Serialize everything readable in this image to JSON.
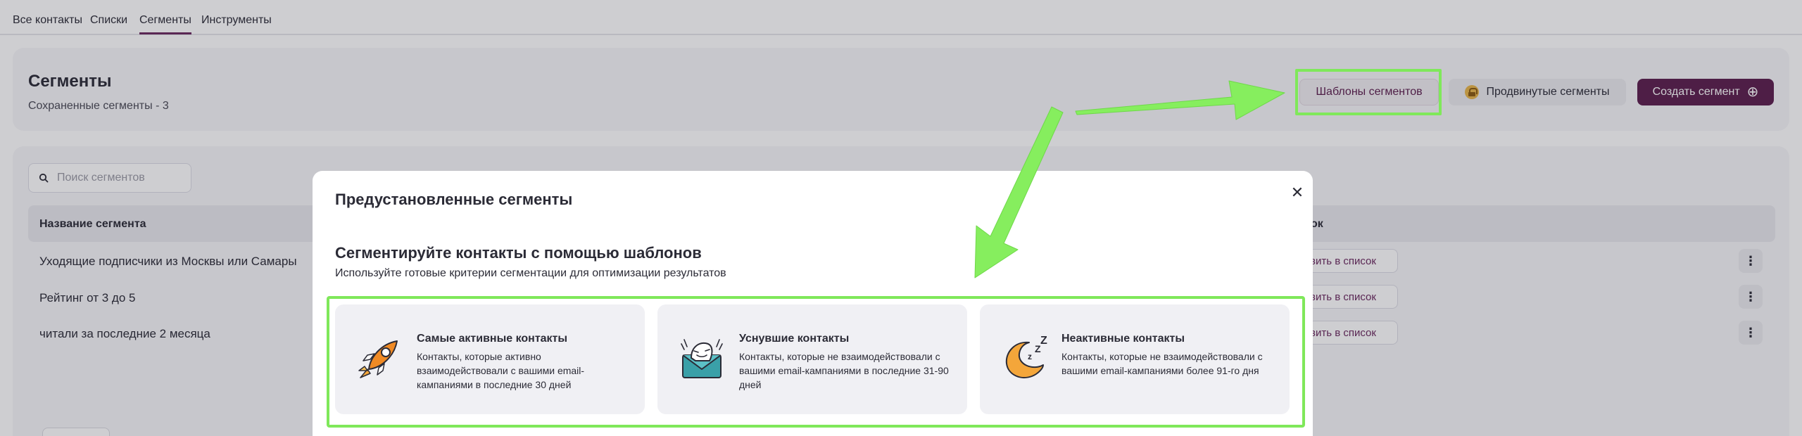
{
  "tabs": [
    {
      "label": "Все контакты",
      "active": false
    },
    {
      "label": "Списки",
      "active": false
    },
    {
      "label": "Сегменты",
      "active": true
    },
    {
      "label": "Инструменты",
      "active": false
    }
  ],
  "header": {
    "title": "Сегменты",
    "saved_count_text": "Сохраненные сегменты - 3",
    "templates_button": "Шаблоны сегментов",
    "advanced_button": "Продвинутые сегменты",
    "create_button": "Создать сегмент",
    "create_icon": "⊕"
  },
  "search": {
    "placeholder": "Поиск сегментов",
    "value": ""
  },
  "table": {
    "col_name": "Название сегмента",
    "col_add_partial": "ок",
    "rows": [
      {
        "name": "Уходящие подписчики из Москвы или Самары",
        "action": "вить в список",
        "menu": "⋮"
      },
      {
        "name": "Рейтинг от 3 до 5",
        "action": "вить в список",
        "menu": "⋮"
      },
      {
        "name": "читали за последние 2 месяца",
        "action": "вить в список",
        "menu": "⋮"
      }
    ]
  },
  "modal": {
    "title": "Предустановленные сегменты",
    "close": "✕",
    "heading": "Сегментируйте контакты с помощью шаблонов",
    "description": "Используйте готовые критерии сегментации для оптимизации результатов",
    "cards": [
      {
        "title": "Самые активные контакты",
        "text": "Контакты, которые активно взаимодействовали с вашими email-кампаниями в последние 30 дней",
        "icon": "rocket-icon"
      },
      {
        "title": "Уснувшие контакты",
        "text": "Контакты, которые не взаимодействовали с вашими email-кампаниями в последние 31-90 дней",
        "icon": "sleeping-envelope-icon"
      },
      {
        "title": "Неактивные контакты",
        "text": "Контакты, которые не взаимодействовали с вашими email-кампаниями более 91-го дня",
        "icon": "moon-icon"
      }
    ]
  },
  "colors": {
    "accent": "#5b1e4e",
    "highlight": "#7fe85a",
    "overlay": "rgba(34,34,44,0.22)"
  }
}
